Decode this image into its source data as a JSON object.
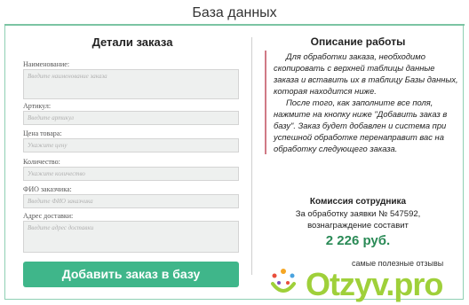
{
  "header": {
    "title": "База данных"
  },
  "order_form": {
    "title": "Детали заказа",
    "fields": [
      {
        "label": "Наименование:",
        "placeholder": "Введите наименование заказа"
      },
      {
        "label": "Артикул:",
        "placeholder": "Введите артикул"
      },
      {
        "label": "Цена товара:",
        "placeholder": "Укажите цену"
      },
      {
        "label": "Количество:",
        "placeholder": "Укажите количество"
      },
      {
        "label": "ФИО заказчика:",
        "placeholder": "Введите ФИО заказчика"
      },
      {
        "label": "Адрес доставки:",
        "placeholder": "Введите адрес доставки"
      }
    ],
    "submit_label": "Добавить заказ в базу"
  },
  "work_description": {
    "title": "Описание работы",
    "paragraph1": "Для обработки заказа, необходимо скопировать с верхней таблицы данные заказа и вставить их в таблицу Базы данных, которая находится ниже.",
    "paragraph2": "После того, как заполните все поля, нажмите на кнопку ниже \"Добавить заказ в базу\". Заказ будет добавлен и система при успешной обработке перенаправит вас на обработку следующего заказа."
  },
  "commission": {
    "title": "Комиссия сотрудника",
    "line1": "За обработку заявки № 547592,",
    "line2": "вознаграждение составит",
    "amount": "2 226 руб."
  },
  "watermark": {
    "tagline": "самые полезные отзывы",
    "logo_text": "Otzyv.pro"
  },
  "colors": {
    "accent_green": "#3fb68a",
    "amount_green": "#2a8a56",
    "quote_border": "#d07a86",
    "logo_green": "#9fd03a"
  }
}
